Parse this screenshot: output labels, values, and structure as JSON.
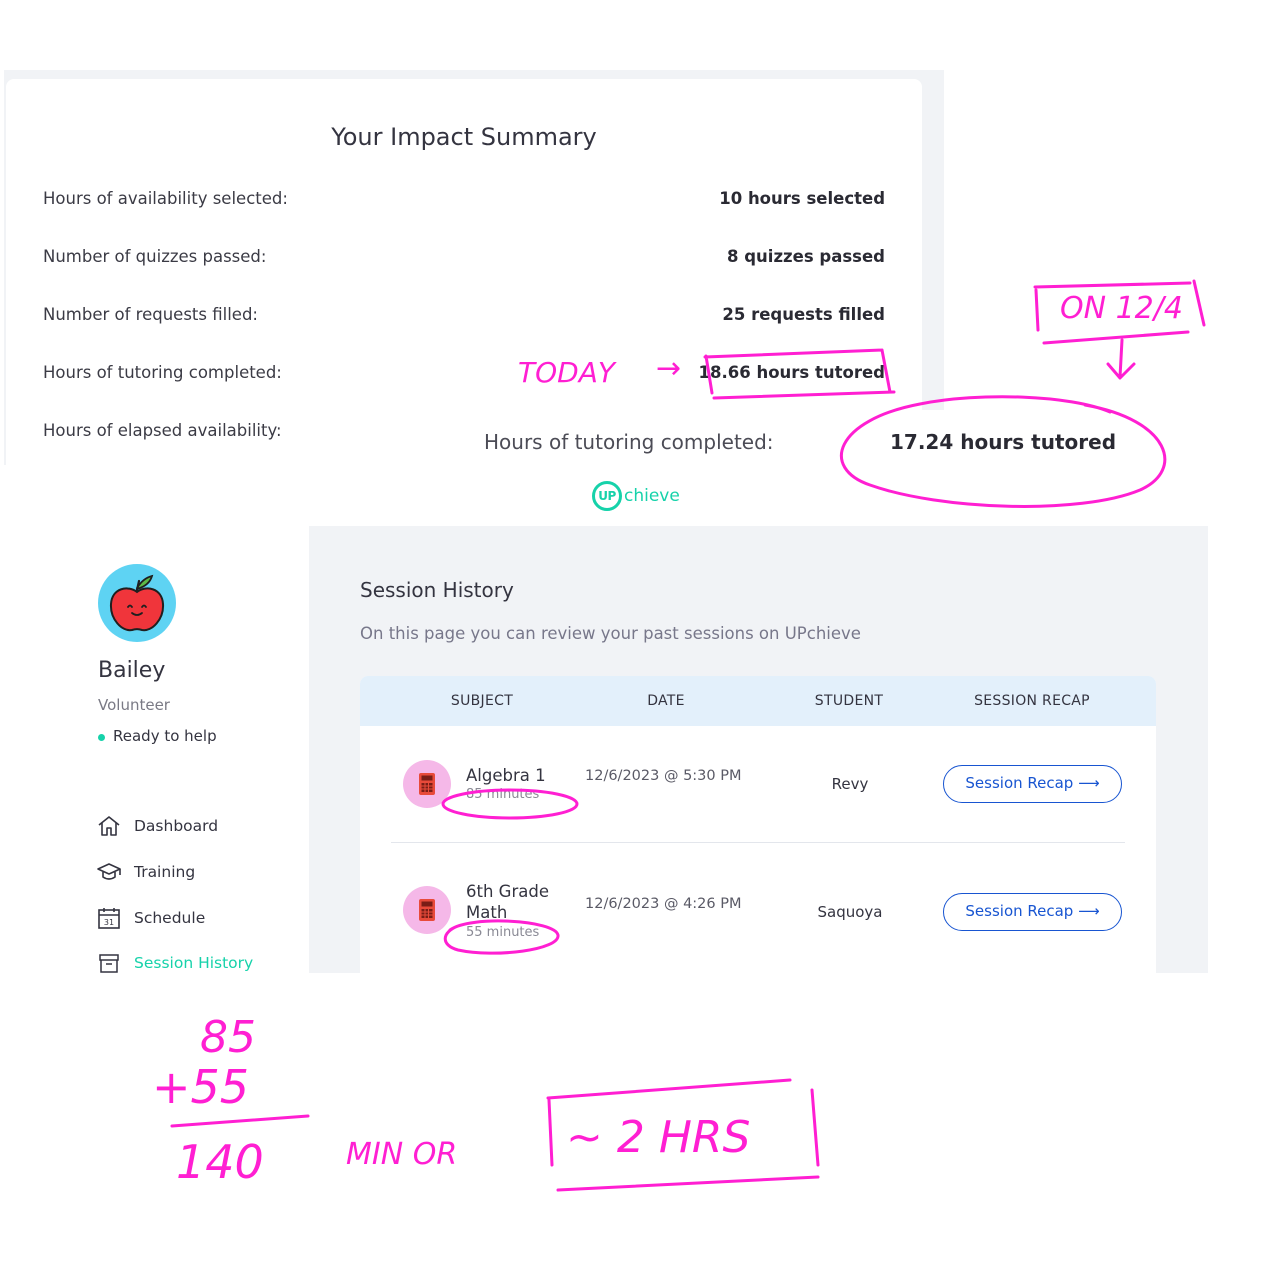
{
  "impact_summary": {
    "title": "Your Impact Summary",
    "rows": [
      {
        "label": "Hours of availability selected:",
        "value": "10 hours selected"
      },
      {
        "label": "Number of quizzes passed:",
        "value": "8 quizzes passed"
      },
      {
        "label": "Number of requests filled:",
        "value": "25 requests filled"
      },
      {
        "label": "Hours of tutoring completed:",
        "value": "18.66 hours tutored"
      },
      {
        "label": "Hours of elapsed availability:",
        "value": ""
      }
    ]
  },
  "overlay_snippet": {
    "label": "Hours of tutoring completed:",
    "value": "17.24 hours tutored"
  },
  "logo": {
    "badge": "UP",
    "text": "chieve",
    "color": "#16d2aa"
  },
  "sidebar": {
    "user_name": "Bailey",
    "user_role": "Volunteer",
    "status": "Ready to help",
    "avatar_icon": "apple-icon",
    "nav": [
      {
        "label": "Dashboard",
        "icon": "home-icon",
        "active": false
      },
      {
        "label": "Training",
        "icon": "graduation-cap-icon",
        "active": false
      },
      {
        "label": "Schedule",
        "icon": "calendar-icon",
        "active": false,
        "icon_text": "31"
      },
      {
        "label": "Session History",
        "icon": "archive-box-icon",
        "active": true
      }
    ]
  },
  "session_history": {
    "title": "Session History",
    "subtitle": "On this page you can review your past sessions on UPchieve",
    "columns": [
      "SUBJECT",
      "DATE",
      "STUDENT",
      "SESSION RECAP"
    ],
    "rows": [
      {
        "subject": "Algebra 1",
        "duration": "85 minutes",
        "date": "12/6/2023 @ 5:30 PM",
        "student": "Revy",
        "recap": "Session Recap ⟶",
        "icon": "calculator-icon"
      },
      {
        "subject": "6th Grade Math",
        "duration": "55 minutes",
        "date": "12/6/2023 @ 4:26 PM",
        "student": "Saquoya",
        "recap": "Session Recap ⟶",
        "icon": "calculator-icon"
      }
    ]
  },
  "annotations": {
    "color": "#ff1fd2",
    "today": "TODAY",
    "arrow": "→",
    "on_date": "ON 12/4",
    "down_arrow": "↓",
    "sum_a": "85",
    "sum_b": "+55",
    "sum_total": "140",
    "min_or": "MIN OR",
    "approx": "~ 2 HRS"
  },
  "colors": {
    "accent": "#16d2aa",
    "link": "#1855d1",
    "table_header": "#e3f0fb",
    "main_bg": "#f1f3f6"
  }
}
